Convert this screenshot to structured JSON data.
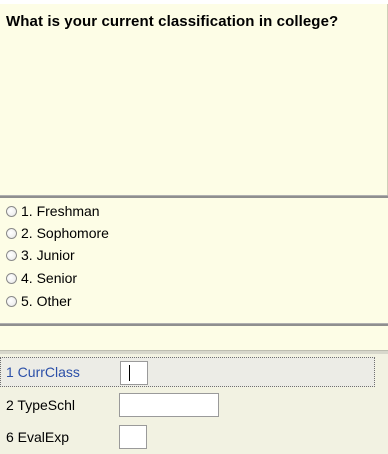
{
  "question": {
    "text": "What is your current classification in college?"
  },
  "options": [
    {
      "label": "1. Freshman",
      "selected": false
    },
    {
      "label": "2. Sophomore",
      "selected": false
    },
    {
      "label": "3. Junior",
      "selected": false
    },
    {
      "label": "4. Senior",
      "selected": false
    },
    {
      "label": "5. Other",
      "selected": false
    }
  ],
  "variables": [
    {
      "label": "1 CurrClass",
      "value": "",
      "active": true
    },
    {
      "label": "2 TypeSchl",
      "value": "",
      "active": false
    },
    {
      "label": "6 EvalExp",
      "value": "",
      "active": false
    }
  ],
  "colors": {
    "panel_bg": "#fdfde6",
    "active_label": "#2b4fa8"
  }
}
